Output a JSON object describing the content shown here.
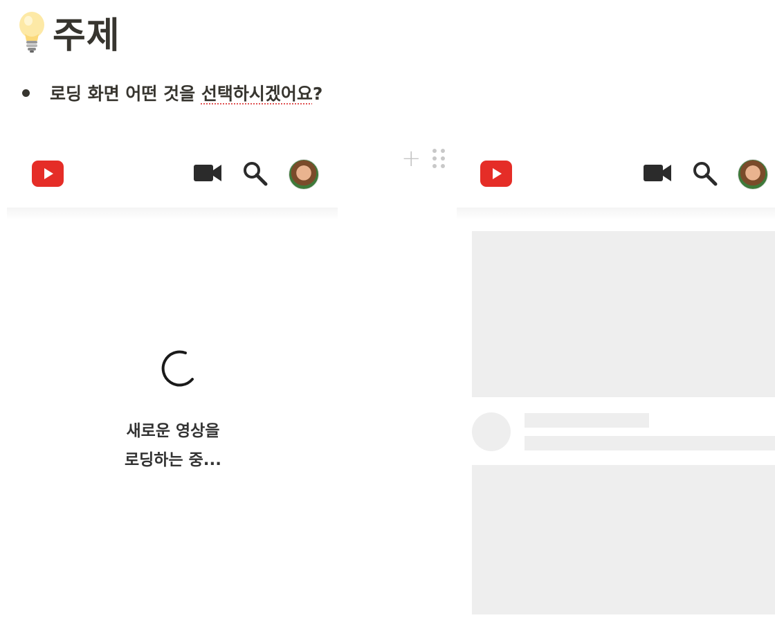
{
  "heading": {
    "title": "주제",
    "icon": "light-bulb-icon"
  },
  "bullet": {
    "text_plain": "로딩 화면 어떤 것을 ",
    "text_underlined": "선택하시겠어요",
    "text_end": "?"
  },
  "editor": {
    "add_block_icon": "plus-icon",
    "drag_handle_icon": "drag-dots-icon"
  },
  "left_mockup": {
    "logo": "youtube-logo-icon",
    "icons": [
      "video-camera-icon",
      "search-icon",
      "avatar"
    ],
    "loading_line1": "새로운 영상을",
    "loading_line2": "로딩하는 중..."
  },
  "right_mockup": {
    "logo": "youtube-logo-icon",
    "icons": [
      "video-camera-icon",
      "search-icon",
      "avatar"
    ],
    "skeleton": "placeholder-cards"
  },
  "colors": {
    "youtube_red": "#e52d27",
    "skeleton_gray": "#eeeeee",
    "text_dark": "#37352f",
    "spellcheck_red": "#e05252"
  }
}
